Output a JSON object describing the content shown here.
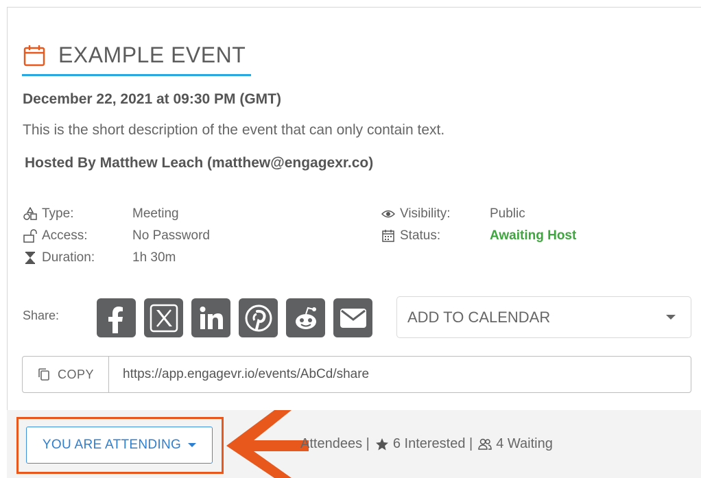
{
  "event": {
    "title": "EXAMPLE EVENT",
    "datetime": "December 22, 2021 at 09:30 PM (GMT)",
    "description": "This is the short description of the event that can only contain text.",
    "host": "Hosted By Matthew Leach (matthew@engagexr.co)"
  },
  "details": {
    "type_label": "Type:",
    "type_value": "Meeting",
    "access_label": "Access:",
    "access_value": "No Password",
    "duration_label": "Duration:",
    "duration_value": "1h 30m",
    "visibility_label": "Visibility:",
    "visibility_value": "Public",
    "status_label": "Status:",
    "status_value": "Awaiting Host"
  },
  "share": {
    "label": "Share:",
    "networks": [
      "facebook-icon",
      "x-icon",
      "linkedin-icon",
      "pinterest-icon",
      "reddit-icon",
      "email-icon"
    ],
    "calendar_label": "ADD TO CALENDAR",
    "copy_label": "COPY",
    "url": "https://app.engagevr.io/events/AbCd/share"
  },
  "footer": {
    "attend_label": "YOU ARE ATTENDING",
    "attendees_text": "Attendees |",
    "interested_text": "6 Interested |",
    "waiting_text": "4 Waiting"
  },
  "colors": {
    "accent_orange": "#e8581c",
    "title_underline": "#29a8e0",
    "status_green": "#3fa63f",
    "attend_blue": "#2f7fd0",
    "social_gray": "#5f6062"
  }
}
